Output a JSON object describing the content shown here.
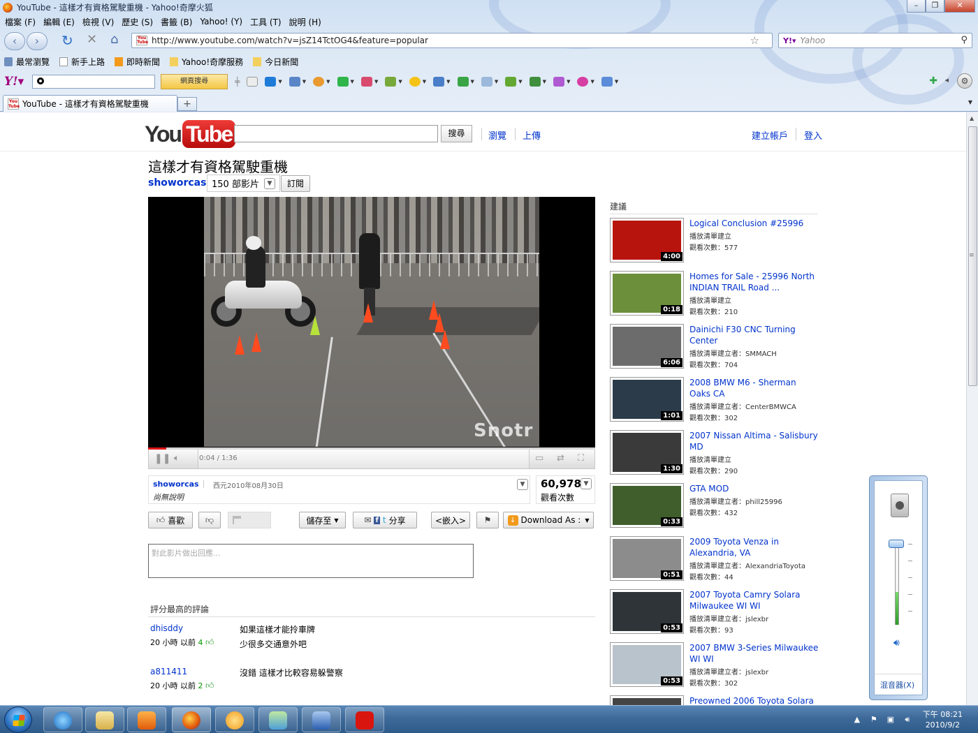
{
  "window": {
    "title": "YouTube - 這樣才有資格駕駛重機 - Yahoo!奇摩火狐"
  },
  "menu": [
    "檔案 (F)",
    "編輯 (E)",
    "檢視 (V)",
    "歷史 (S)",
    "書籤 (B)",
    "Yahoo! (Y)",
    "工具 (T)",
    "說明 (H)"
  ],
  "navigation": {
    "url": "http://www.youtube.com/watch?v=jsZ14TctOG4&feature=popular",
    "search_placeholder": "Yahoo"
  },
  "bookmarks": [
    "最常瀏覽",
    "新手上路",
    "即時新聞",
    "Yahoo!奇摩服務",
    "今日新聞"
  ],
  "yahoo_toolbar": {
    "search_button": "網頁搜尋"
  },
  "tabs": [
    {
      "label": "YouTube - 這樣才有資格駕駛重機"
    }
  ],
  "youtube": {
    "search_button": "搜尋",
    "browse": "瀏覽",
    "upload": "上傳",
    "signup": "建立帳戶",
    "signin": "登入"
  },
  "video": {
    "title": "這樣才有資格駕駛重機",
    "channel": "showorcas",
    "video_count": "150 部影片",
    "subscribe": "訂閱",
    "watermark": "Snotr",
    "time": "0:04 / 1:36",
    "progress_fraction": 0.04,
    "uploader": "showorcas",
    "date": "西元2010年08月30日",
    "description": "尚無說明",
    "views": "60,978",
    "views_label": "觀看次數"
  },
  "actions": {
    "like": "喜歡",
    "save_to": "儲存至",
    "share": "分享",
    "embed": "<嵌入>",
    "download": "Download As :"
  },
  "comments": {
    "input_placeholder": "對此影片做出回應...",
    "heading": "評分最高的評論",
    "items": [
      {
        "user": "dhisddy",
        "meta": "20 小時 以前",
        "likes": "4",
        "lines": [
          "如果這樣才能拎車牌",
          "少很多交通意外吧"
        ]
      },
      {
        "user": "a811411",
        "meta": "20 小時 以前",
        "likes": "2",
        "lines": [
          "沒錯 這樣才比較容易躲警察"
        ]
      }
    ]
  },
  "suggestions": {
    "heading": "建議",
    "items": [
      {
        "title": "Logical Conclusion #25996",
        "line1": "播放清單建立",
        "line2": "觀看次數：577",
        "duration": "4:00",
        "thumb_color": "#b8140e"
      },
      {
        "title": "Homes for Sale - 25996 North INDIAN TRAIL Road ...",
        "line1": "播放清單建立",
        "line2": "觀看次數：210",
        "duration": "0:18",
        "thumb_color": "#6b8f3a"
      },
      {
        "title": "Dainichi F30 CNC Turning Center",
        "line1": "播放清單建立者：SMMACH",
        "line2": "觀看次數：704",
        "duration": "6:06",
        "thumb_color": "#6c6c6c"
      },
      {
        "title": "2008 BMW M6 - Sherman Oaks CA",
        "line1": "播放清單建立者：CenterBMWCA",
        "line2": "觀看次數：302",
        "duration": "1:01",
        "thumb_color": "#2b3b4a"
      },
      {
        "title": "2007 Nissan Altima - Salisbury MD",
        "line1": "播放清單建立",
        "line2": "觀看次數：290",
        "duration": "1:30",
        "thumb_color": "#3a3a3a"
      },
      {
        "title": "GTA MOD",
        "line1": "播放清單建立者：phill25996",
        "line2": "觀看次數：432",
        "duration": "0:33",
        "thumb_color": "#3f5e2c"
      },
      {
        "title": "2009 Toyota Venza in Alexandria, VA",
        "line1": "播放清單建立者：AlexandriaToyota",
        "line2": "觀看次數：44",
        "duration": "0:51",
        "thumb_color": "#8c8c8c"
      },
      {
        "title": "2007 Toyota Camry Solara Milwaukee WI WI",
        "line1": "播放清單建立者：jslexbr",
        "line2": "觀看次數：93",
        "duration": "0:53",
        "thumb_color": "#2f3438"
      },
      {
        "title": "2007 BMW 3-Series Milwaukee WI WI",
        "line1": "播放清單建立者：jslexbr",
        "line2": "觀看次數：302",
        "duration": "0:53",
        "thumb_color": "#b9c3cc"
      },
      {
        "title": "Preowned 2006 Toyota Solara",
        "line1": "",
        "line2": "",
        "duration": "",
        "thumb_color": "#444444"
      }
    ]
  },
  "volume": {
    "mixer": "混音器(X)",
    "level_fraction": 0.4
  },
  "taskbar": {
    "time": "下午 08:21",
    "date": "2010/9/2"
  }
}
